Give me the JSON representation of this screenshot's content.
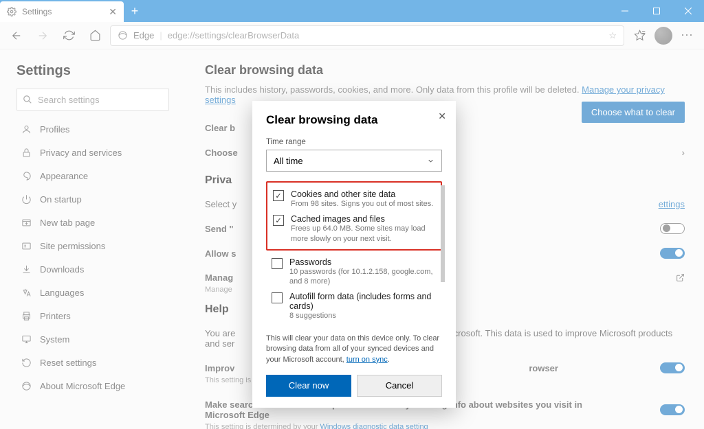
{
  "tab": {
    "title": "Settings"
  },
  "address": {
    "prefix": "Edge",
    "url": "edge://settings/clearBrowserData"
  },
  "sidebar": {
    "title": "Settings",
    "search_placeholder": "Search settings",
    "items": [
      {
        "label": "Profiles",
        "icon": "user"
      },
      {
        "label": "Privacy and services",
        "icon": "lock"
      },
      {
        "label": "Appearance",
        "icon": "appearance"
      },
      {
        "label": "On startup",
        "icon": "power"
      },
      {
        "label": "New tab page",
        "icon": "tab"
      },
      {
        "label": "Site permissions",
        "icon": "permissions"
      },
      {
        "label": "Downloads",
        "icon": "download"
      },
      {
        "label": "Languages",
        "icon": "language"
      },
      {
        "label": "Printers",
        "icon": "printer"
      },
      {
        "label": "System",
        "icon": "system"
      },
      {
        "label": "Reset settings",
        "icon": "reset"
      },
      {
        "label": "About Microsoft Edge",
        "icon": "edge"
      }
    ]
  },
  "main": {
    "h_clear": "Clear browsing data",
    "desc": "This includes history, passwords, cookies, and more. Only data from this profile will be deleted. ",
    "desc_link": "Manage your privacy settings",
    "choose_btn": "Choose what to clear",
    "row_clear_now": "Clear b",
    "row_choose": "Choose",
    "h_privacy": "Priva",
    "select_txt": "Select y",
    "select_link": "ettings",
    "send_txt": "Send \"",
    "allow_txt": "Allow s",
    "manage_txt": "Manag",
    "manage_sub": "Manage",
    "h_help": "Help",
    "help_desc_a": "You are",
    "help_desc_b": " Microsoft. This data is used to improve Microsoft products and ser",
    "improv_txt": "Improv",
    "improv_b": "rowser",
    "setting_note": "This setting is determined by your ",
    "setting_link": "Windows diagnostic data setting",
    "searches_txt": "Make searches and Microsoft products better by sending info about websites you visit in Microsoft Edge"
  },
  "dialog": {
    "title": "Clear browsing data",
    "time_label": "Time range",
    "time_value": "All time",
    "items": [
      {
        "title": "Cookies and other site data",
        "sub": "From 98 sites. Signs you out of most sites.",
        "checked": true
      },
      {
        "title": "Cached images and files",
        "sub": "Frees up 64.0 MB. Some sites may load more slowly on your next visit.",
        "checked": true
      },
      {
        "title": "Passwords",
        "sub": "10 passwords (for 10.1.2.158, google.com, and 8 more)",
        "checked": false
      },
      {
        "title": "Autofill form data (includes forms and cards)",
        "sub": "8 suggestions",
        "checked": false
      }
    ],
    "note_a": "This will clear your data on this device only. To clear browsing data from all of your synced devices and your Microsoft account, ",
    "note_link": "turn on sync",
    "btn_clear": "Clear now",
    "btn_cancel": "Cancel"
  }
}
